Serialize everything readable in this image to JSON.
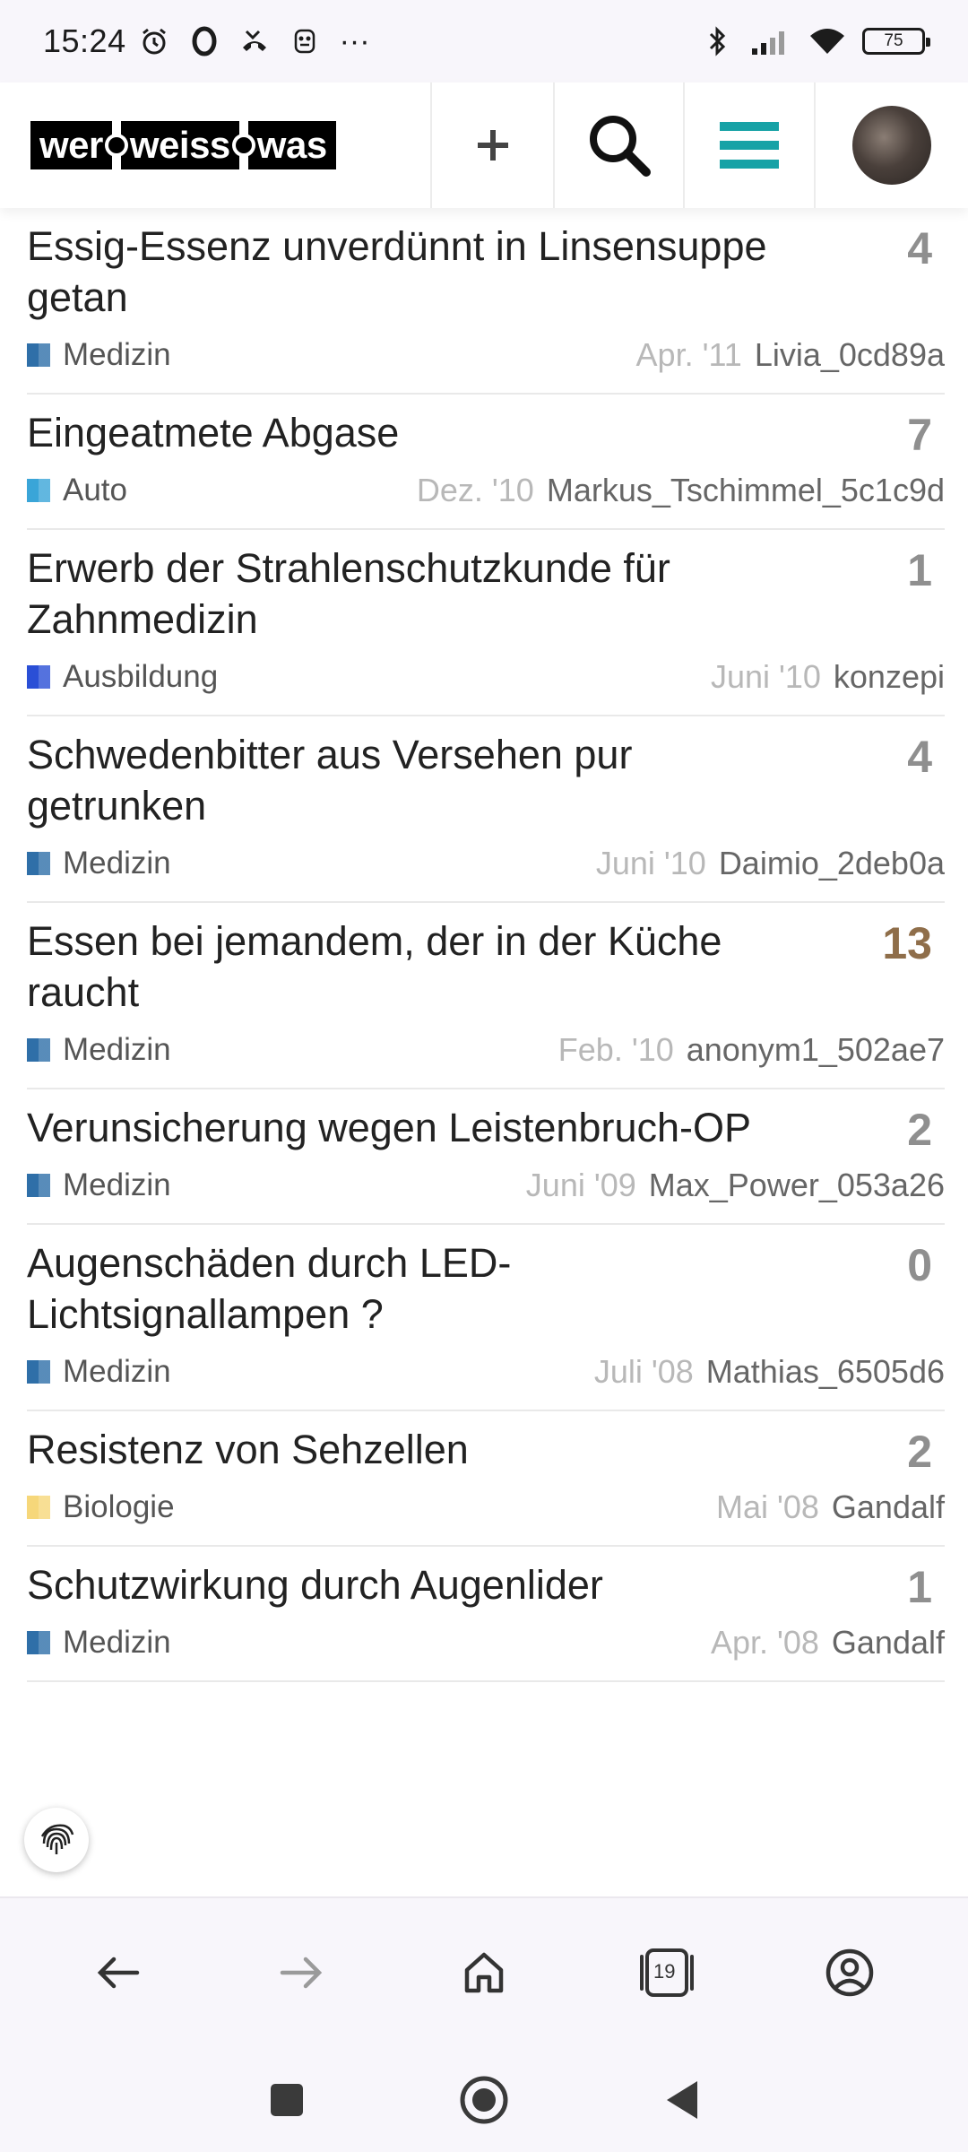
{
  "status_bar": {
    "time": "15:24",
    "more": "···",
    "battery": "75"
  },
  "header": {
    "logo": [
      "wer",
      "weiss",
      "was"
    ],
    "colors": {
      "menu_accent": "#17a2a6"
    }
  },
  "topics": [
    {
      "title": "Essig-Essenz unverdünnt in Linsensuppe getan",
      "count": "4",
      "hot": false,
      "category": "Medizin",
      "category_color": "#2f6fa8",
      "date": "Apr. '11",
      "user": "Livia_0cd89a"
    },
    {
      "title": "Eingeatmete Abgase",
      "count": "7",
      "hot": false,
      "category": "Auto",
      "category_color": "#3aa5d8",
      "date": "Dez. '10",
      "user": "Markus_Tschimmel_5c1c9d"
    },
    {
      "title": "Erwerb der Strahlenschutzkunde für Zahnmedizin",
      "count": "1",
      "hot": false,
      "category": "Ausbildung",
      "category_color": "#2a4fd6",
      "date": "Juni '10",
      "user": "konzepi"
    },
    {
      "title": "Schwedenbitter aus Versehen pur getrunken",
      "count": "4",
      "hot": false,
      "category": "Medizin",
      "category_color": "#2f6fa8",
      "date": "Juni '10",
      "user": "Daimio_2deb0a"
    },
    {
      "title": "Essen bei jemandem, der in der Küche raucht",
      "count": "13",
      "hot": true,
      "category": "Medizin",
      "category_color": "#2f6fa8",
      "date": "Feb. '10",
      "user": "anonym1_502ae7"
    },
    {
      "title": "Verunsicherung wegen Leistenbruch-OP",
      "count": "2",
      "hot": false,
      "category": "Medizin",
      "category_color": "#2f6fa8",
      "date": "Juni '09",
      "user": "Max_Power_053a26"
    },
    {
      "title": "Augenschäden durch LED-Lichtsignallampen ?",
      "count": "0",
      "hot": false,
      "category": "Medizin",
      "category_color": "#2f6fa8",
      "date": "Juli '08",
      "user": "Mathias_6505d6"
    },
    {
      "title": "Resistenz von Sehzellen",
      "count": "2",
      "hot": false,
      "category": "Biologie",
      "category_color": "#f6d77a",
      "date": "Mai '08",
      "user": "Gandalf"
    },
    {
      "title": "Schutzwirkung durch Augenlider",
      "count": "1",
      "hot": false,
      "category": "Medizin",
      "category_color": "#2f6fa8",
      "date": "Apr. '08",
      "user": "Gandalf"
    }
  ],
  "browser_nav": {
    "tab_count": "19"
  }
}
